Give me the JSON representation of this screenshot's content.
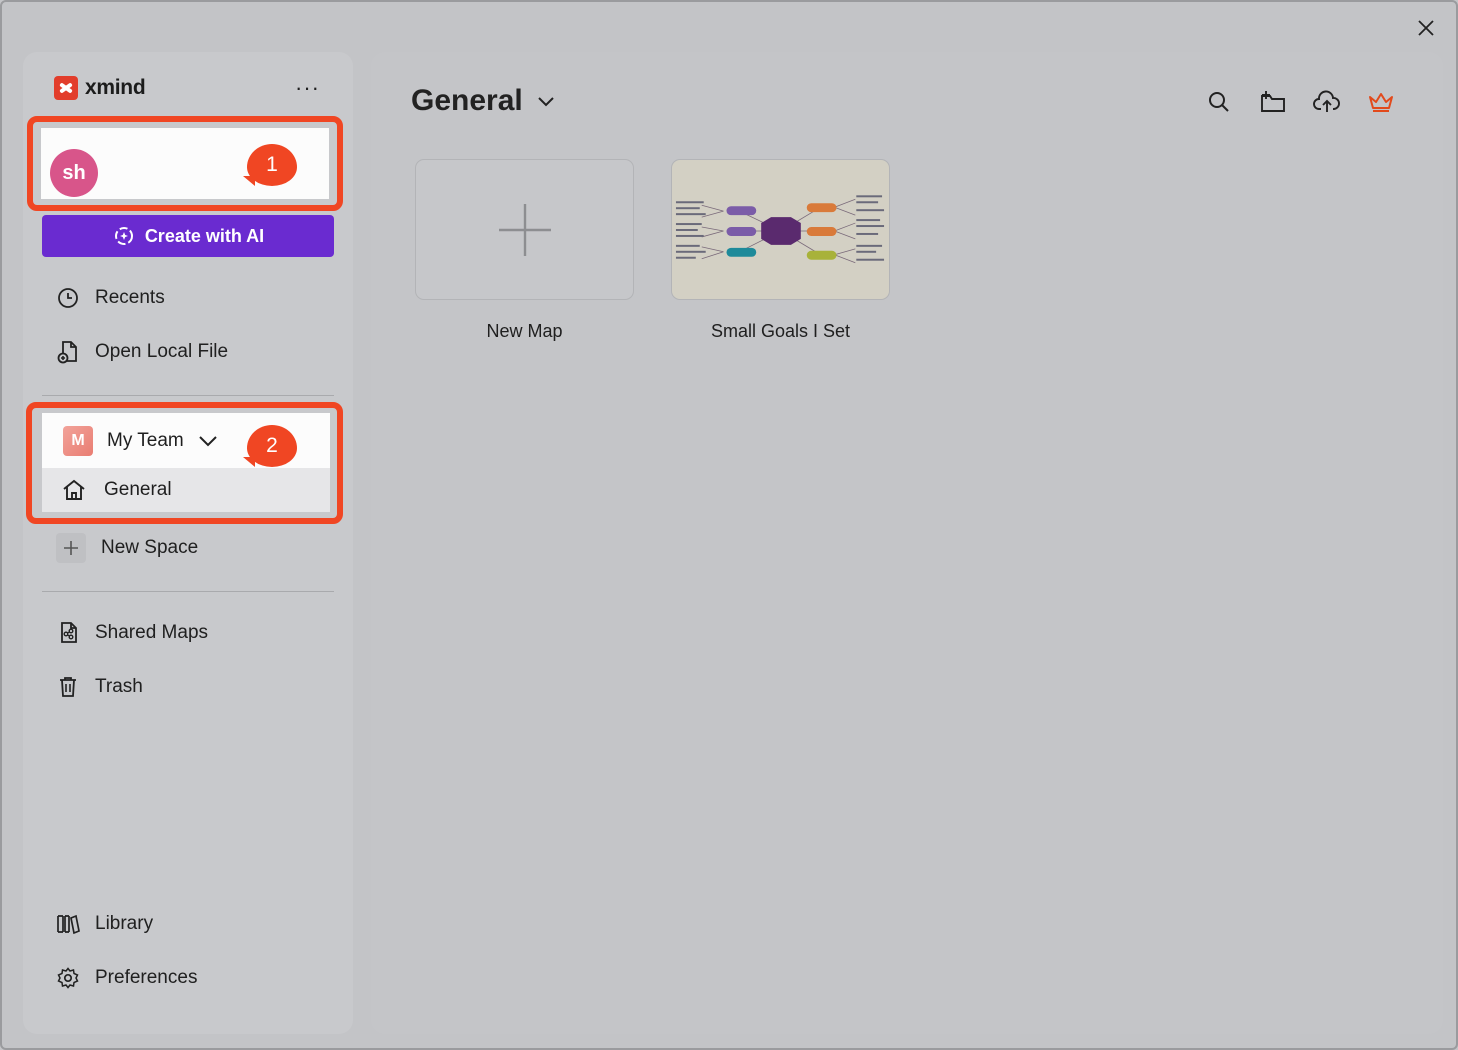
{
  "app": {
    "brand": "xmind",
    "more": "···"
  },
  "account": {
    "avatar_initials": "sh",
    "callout": "1"
  },
  "sidebar": {
    "create_ai_label": "Create with AI",
    "recents_label": "Recents",
    "open_local_label": "Open Local File",
    "team": {
      "letter": "M",
      "name": "My Team",
      "callout": "2",
      "general_label": "General"
    },
    "new_space_label": "New Space",
    "shared_maps_label": "Shared Maps",
    "trash_label": "Trash",
    "library_label": "Library",
    "preferences_label": "Preferences"
  },
  "main": {
    "title": "General",
    "cards": [
      {
        "label": "New Map"
      },
      {
        "label": "Small Goals I Set"
      }
    ]
  },
  "colors": {
    "accent_orange": "#f04623",
    "ai_purple": "#6a2bd0",
    "avatar_pink": "#d8558a",
    "crown": "#e24a1c"
  }
}
